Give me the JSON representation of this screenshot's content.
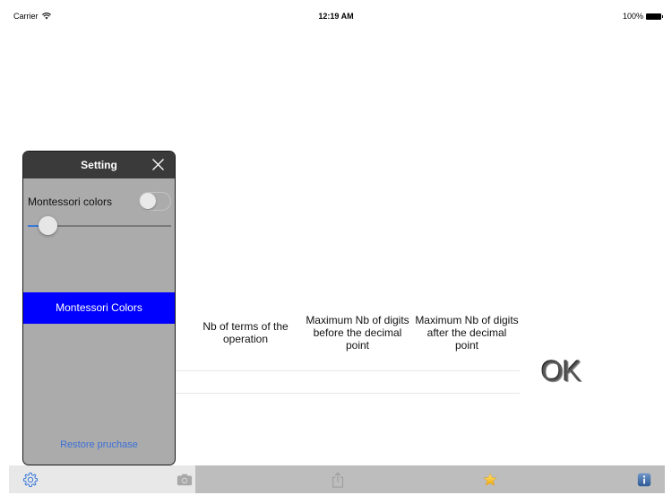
{
  "status_bar": {
    "carrier": "Carrier",
    "time": "12:19 AM",
    "battery": "100%"
  },
  "table": {
    "headers": [
      "Nb of terms of the operation",
      "Maximum Nb of digits before the decimal point",
      "Maximum Nb of digits after the decimal point"
    ],
    "ok_label": "OK"
  },
  "settings_panel": {
    "title": "Setting",
    "montessori_toggle_label": "Montessori colors",
    "montessori_toggle_on": false,
    "slider_value": 0.14,
    "colors_button_label": "Montessori Colors",
    "colors_button_color": "#0000ff",
    "restore_label": "Restore pruchase"
  },
  "toolbar": {
    "icons": [
      "gear-icon",
      "camera-icon",
      "share-icon",
      "star-icon",
      "info-icon"
    ]
  },
  "colors": {
    "accent": "#3a6fd8",
    "panel_bg": "#ababab",
    "panel_header": "#3a3a3a",
    "toolbar_bg": "#bdbdbd"
  }
}
